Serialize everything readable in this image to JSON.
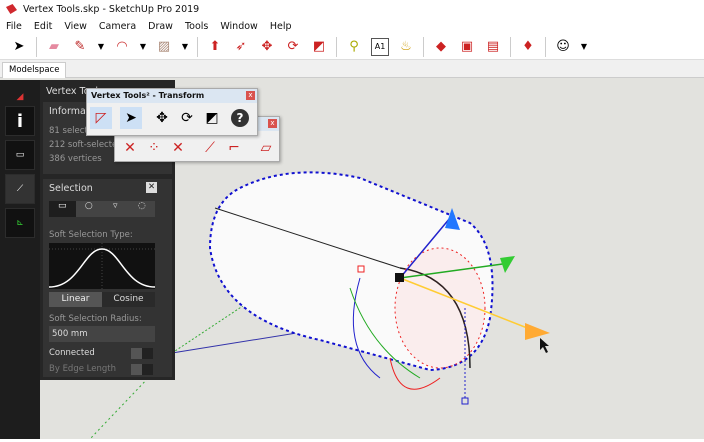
{
  "window": {
    "title": "Vertex Tools.skp - SketchUp Pro 2019"
  },
  "menu": [
    "File",
    "Edit",
    "View",
    "Camera",
    "Draw",
    "Tools",
    "Window",
    "Help"
  ],
  "toolbar": {
    "icons": [
      "select-icon",
      "eraser-icon",
      "pencil-icon",
      "dropdown-icon",
      "arc-icon",
      "dropdown-icon",
      "rectangle-icon",
      "dropdown-icon",
      "push-pull-icon",
      "follow-me-icon",
      "move-icon",
      "rotate-icon",
      "scale-icon",
      "tape-measure-icon",
      "text-icon",
      "paint-bucket-icon",
      "component-icon",
      "warehouse-icon",
      "extension-icon",
      "ruby-icon",
      "account-icon"
    ]
  },
  "tabs": {
    "modelspace": "Modelspace"
  },
  "panel": {
    "title": "Vertex Tools",
    "information": {
      "heading": "Information",
      "lines": [
        "81 selected",
        "212 soft-selected",
        "386 vertices"
      ]
    },
    "selection": {
      "heading": "Selection",
      "close": "✕",
      "soft_type_label": "Soft Selection Type:",
      "linear": "Linear",
      "cosine": "Cosine",
      "radius_label": "Soft Selection Radius:",
      "radius_value": "500 mm",
      "connected": "Connected",
      "by_edge_length": "By Edge Length"
    }
  },
  "transform_window": {
    "title": "Vertex Tools² - Transform",
    "close": "x",
    "help": "?"
  },
  "second_window": {
    "close": "x"
  },
  "colors": {
    "accent": "#d0282e",
    "panel_bg": "#262626",
    "viewport_bg": "#e2e2de",
    "selected_vertex": "#1010d0"
  }
}
